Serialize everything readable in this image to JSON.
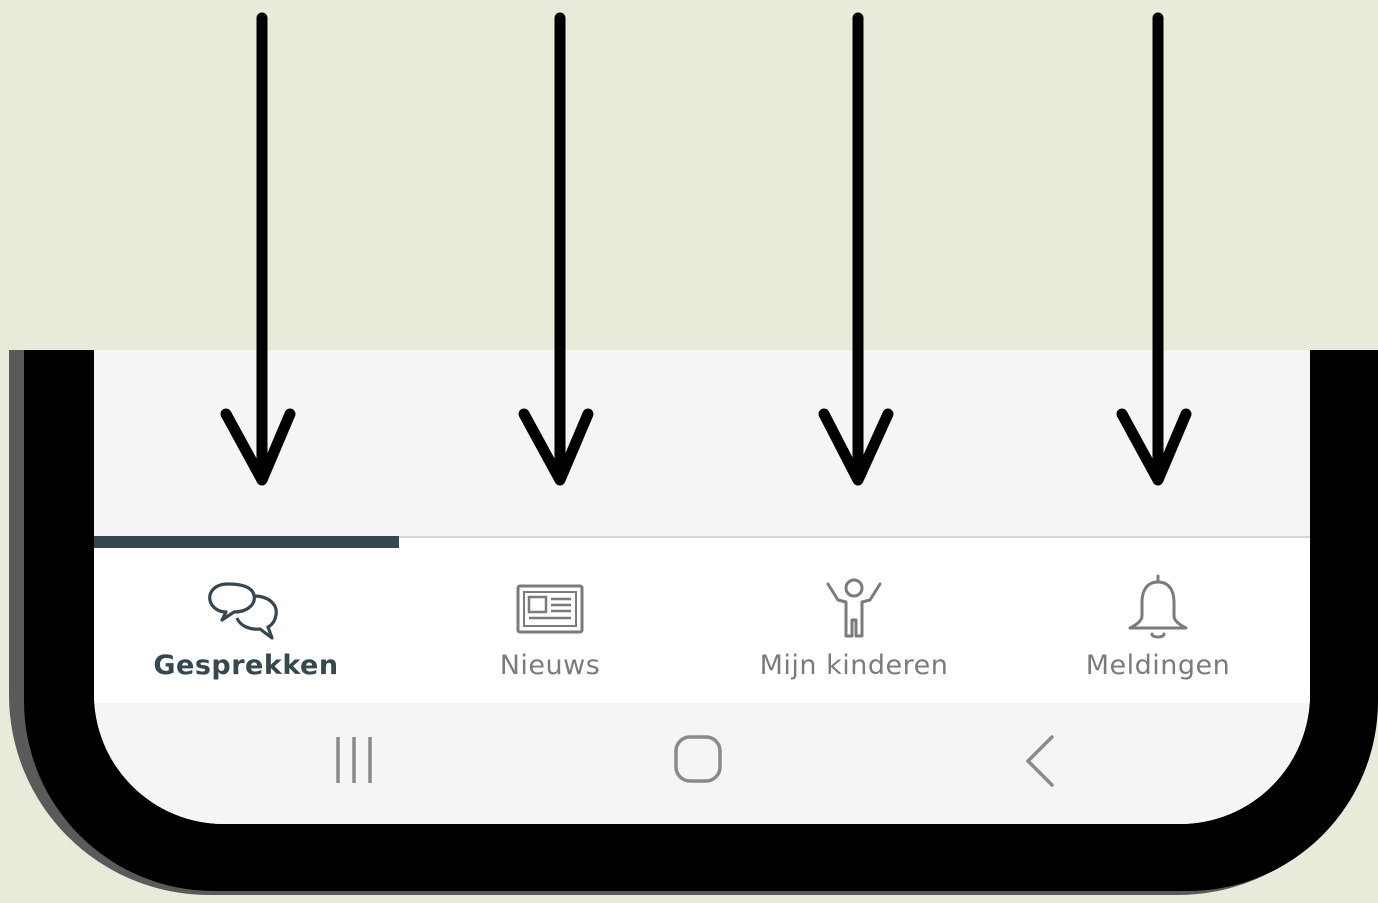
{
  "tabs": [
    {
      "label": "Gesprekken",
      "icon": "chat-bubbles-icon",
      "active": true
    },
    {
      "label": "Nieuws",
      "icon": "newspaper-icon",
      "active": false
    },
    {
      "label": "Mijn kinderen",
      "icon": "child-icon",
      "active": false
    },
    {
      "label": "Meldingen",
      "icon": "bell-icon",
      "active": false
    }
  ],
  "system_nav": {
    "recents_icon": "recents-icon",
    "home_icon": "home-icon",
    "back_icon": "back-icon"
  },
  "colors": {
    "background": "#e8ebda",
    "active_tab": "#36474f",
    "inactive_tab": "#7b7b7b",
    "tabbar": "#ffffff",
    "screen": "#f5f5f5",
    "bezel": "#000000",
    "arrow": "#000000"
  },
  "annotation": {
    "arrow_icon": "down-arrow-icon",
    "arrow_count": 4
  }
}
